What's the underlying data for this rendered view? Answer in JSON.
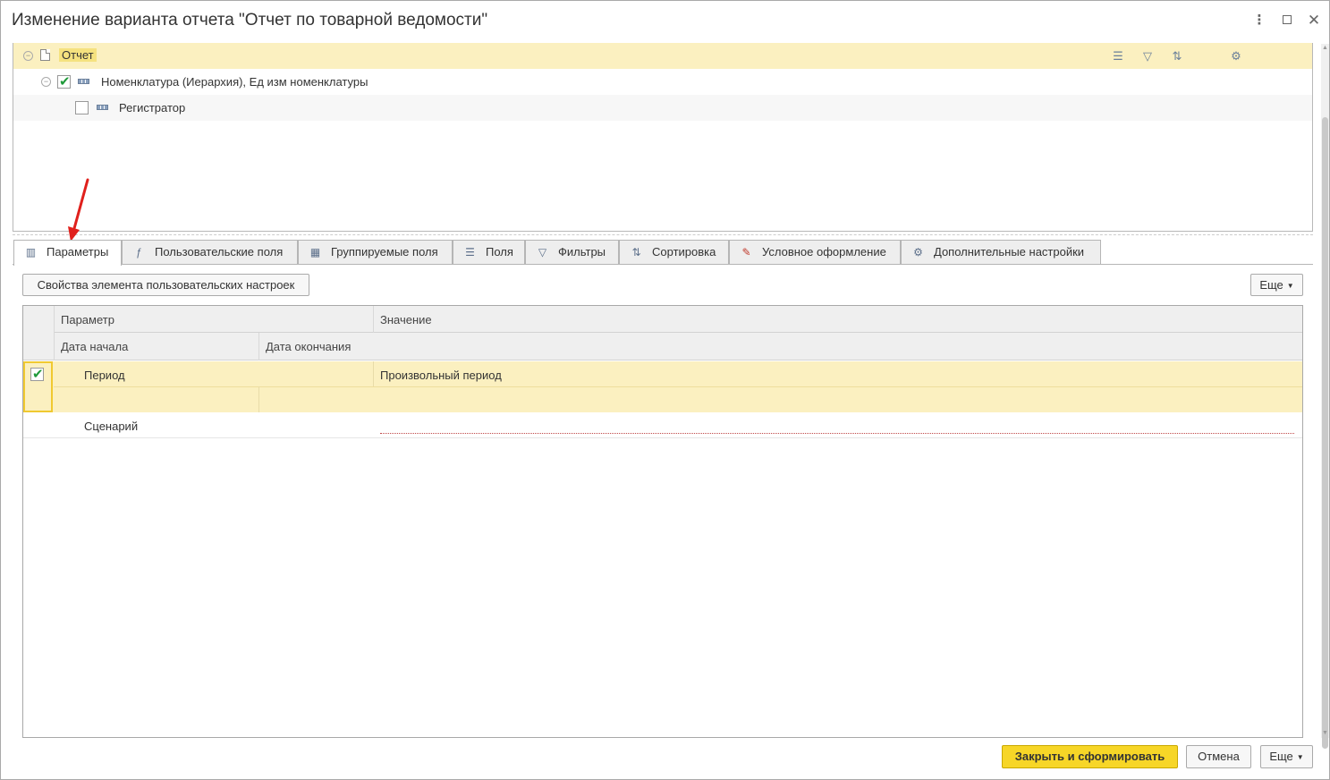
{
  "window": {
    "title": "Изменение варианта отчета \"Отчет по товарной ведомости\"",
    "controls": {
      "more": "⋮",
      "close": "✕"
    }
  },
  "tree": {
    "rows": [
      {
        "label": "Отчет",
        "icon": "document-icon",
        "selected": true
      },
      {
        "label": "Номенклатура (Иерархия), Ед изм номенклатуры",
        "icon": "grouping-icon",
        "checked": true
      },
      {
        "label": "Регистратор",
        "icon": "grouping-icon",
        "checked": false
      }
    ],
    "toolbar_icons": [
      "list-icon",
      "filter-icon",
      "sort-icon",
      "settings-icon"
    ]
  },
  "tabs": [
    {
      "label": "Параметры",
      "icon": "parameters-icon",
      "active": true
    },
    {
      "label": "Пользовательские поля",
      "icon": "custom-fields-icon"
    },
    {
      "label": "Группируемые поля",
      "icon": "grouped-fields-icon"
    },
    {
      "label": "Поля",
      "icon": "fields-icon"
    },
    {
      "label": "Фильтры",
      "icon": "filter-icon"
    },
    {
      "label": "Сортировка",
      "icon": "sort-icon"
    },
    {
      "label": "Условное оформление",
      "icon": "conditional-format-icon"
    },
    {
      "label": "Дополнительные настройки",
      "icon": "additional-settings-icon"
    }
  ],
  "panel": {
    "properties_button": "Свойства элемента пользовательских настроек",
    "more_button": "Еще",
    "grid": {
      "headers": {
        "parameter": "Параметр",
        "value": "Значение",
        "start_date": "Дата начала",
        "end_date": "Дата окончания"
      },
      "rows": [
        {
          "checked": true,
          "parameter": "Период",
          "value": "Произвольный период"
        },
        {
          "checked": false,
          "parameter": "Сценарий",
          "value": ""
        }
      ]
    }
  },
  "footer": {
    "primary": "Закрыть и сформировать",
    "cancel": "Отмена",
    "more": "Еще"
  },
  "colors": {
    "selection": "#fbf0c0",
    "primary_button": "#f7d627",
    "check": "#1f9a3a",
    "annotation_arrow": "#e0201c"
  }
}
